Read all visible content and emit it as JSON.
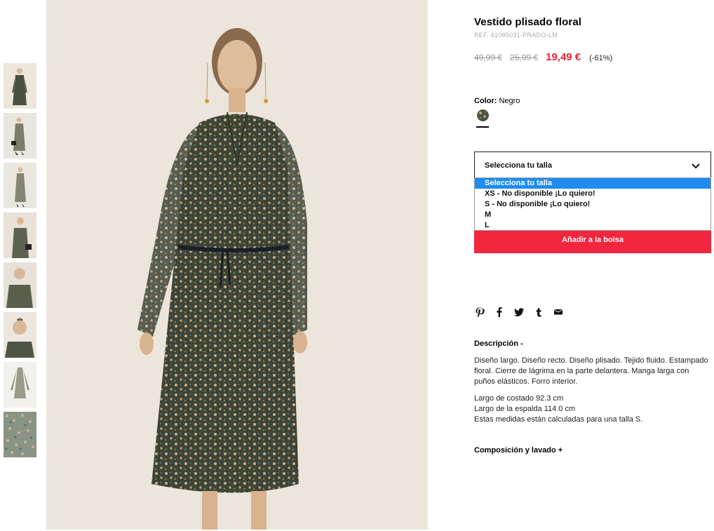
{
  "product": {
    "title": "Vestido plisado floral",
    "ref": "REF. 41085031-PRADO-LM",
    "price_original": "49,99 €",
    "price_previous": "25,99 €",
    "price_current": "19,49 €",
    "discount": "(-61%)"
  },
  "color": {
    "label": "Color:",
    "value": "Negro"
  },
  "size_select": {
    "placeholder": "Selecciona tu talla",
    "options": [
      "Selecciona tu talla",
      "XS - No disponible ¡Lo quiero!",
      "S - No disponible ¡Lo quiero!",
      "M",
      "L"
    ],
    "selected_index": 0
  },
  "add_to_bag": "Añadir a la bolsa",
  "share_icons": [
    "pinterest-icon",
    "facebook-icon",
    "twitter-icon",
    "tumblr-icon",
    "email-icon"
  ],
  "description": {
    "heading": "Descripción -",
    "paragraph1": "Diseño largo. Diseño recto. Diseño plisado. Tejido fluido. Estampado floral. Cierre de lágrima en la parte delantera. Manga larga con puños elásticos. Forro interior.",
    "line1": "Largo de costado 92.3 cm",
    "line2": "Largo de la espalda 114.0 cm",
    "line3": "Estas medidas están calculadas para una talla S."
  },
  "composition": {
    "heading": "Composición y lavado +"
  },
  "colors": {
    "accent": "#f2263f",
    "price_red": "#e8243a",
    "option_highlight": "#1e8cf0"
  }
}
